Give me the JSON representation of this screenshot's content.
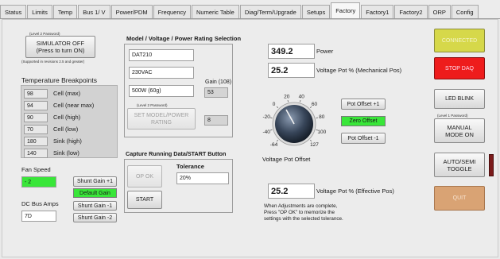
{
  "tabs": [
    "Status",
    "Limits",
    "Temp",
    "Bus 1/ V",
    "Power/PDM",
    "Frequency",
    "Numeric Table",
    "Diag/Term/Upgrade",
    "Setups",
    "Factory",
    "Factory1",
    "Factory2",
    "ORP",
    "Config"
  ],
  "active_tab": "Factory",
  "simulator": {
    "level_note": "(Level 2 Password)",
    "button_label": "SIMULATOR OFF\n(Press to turn ON)",
    "support_note": "(Supported in revisions 2.5 and greater)"
  },
  "temp_breakpoints": {
    "title": "Temperature Breakpoints",
    "rows": [
      {
        "value": "98",
        "label": "Cell (max)"
      },
      {
        "value": "94",
        "label": "Cell (near max)"
      },
      {
        "value": "90",
        "label": "Cell (high)"
      },
      {
        "value": "70",
        "label": "Cell (low)"
      },
      {
        "value": "180",
        "label": "Sink (high)"
      },
      {
        "value": "140",
        "label": "Sink (low)"
      }
    ]
  },
  "fan": {
    "label": "Fan Speed",
    "value": "- 2",
    "shunt_plus": "Shunt Gain +1",
    "default_gain": "Default Gain"
  },
  "dc_bus": {
    "label": "DC Bus Amps",
    "value": "7D",
    "shunt_minus1": "Shunt Gain -1",
    "shunt_minus2": "Shunt Gain -2"
  },
  "model": {
    "title": "Model / Voltage / Power Rating Selection",
    "model": "DAT210",
    "voltage": "230VAC",
    "power": "500W (60g)",
    "gain_label": "Gain (108)",
    "gain_value": "53",
    "level_note": "(Level 2 Password)",
    "set_button": "SET MODEL/POWER\nRATING",
    "set_value": "8"
  },
  "capture": {
    "title": "Capture Running Data/START Button",
    "ok_button": "OP OK",
    "tolerance_label": "Tolerance",
    "tolerance_value": "20%",
    "start_button": "START"
  },
  "readouts": {
    "power_value": "349.2",
    "power_label": "Power",
    "vpot_mech_value": "25.2",
    "vpot_mech_label": "Voltage Pot % (Mechanical Pos)",
    "vpot_eff_value": "25.2",
    "vpot_eff_label": "Voltage Pot % (Effective Pos)"
  },
  "knob": {
    "label": "Voltage Pot Offset",
    "ticks": [
      "-64",
      "-40",
      "-20",
      "0",
      "20",
      "40",
      "60",
      "80",
      "100",
      "127"
    ],
    "value": 0
  },
  "offsets": {
    "plus": "Pot Offset +1",
    "zero": "Zero Offset",
    "minus": "Pot Offset -1"
  },
  "note": "When Adjustments are complete,\nPress \"OP OK\" to memorize the\nsettings with the selected tolerance.",
  "right": {
    "connected": "CONNECTED",
    "stop_daq": "STOP DAQ",
    "led_blink": "LED BLINK",
    "level_note": "(Level 1 Password)",
    "manual": "MANUAL\nMODE ON",
    "auto_semi": "AUTO/SEMI\nTOGGLE",
    "quit": "QUIT"
  },
  "colors": {
    "connected_bg": "#d6d84a",
    "stop_bg": "#ee1c1c",
    "quit_bg": "#d9a374",
    "green": "#39e639",
    "toggle_indicator": "#7b1a1a"
  }
}
